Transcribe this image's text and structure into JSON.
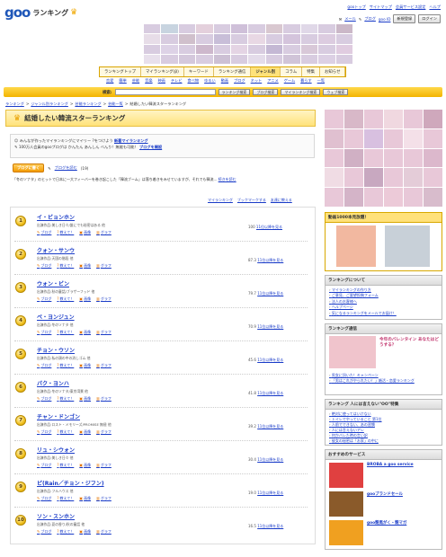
{
  "header": {
    "logo_text": "goo",
    "title": "ランキング",
    "top_links": [
      "gooトップ",
      "サイトマップ",
      "会員サービス設定",
      "ヘルプ"
    ],
    "user_links": [
      "メール",
      "ブログ",
      "goo ID"
    ],
    "register_button": "新規登録",
    "login_button": "ログイン"
  },
  "nav": {
    "tabs": [
      "ランキングトップ",
      "マイランキング(β)",
      "キーワード",
      "ランキング通信",
      "ジャンル別",
      "コラム",
      "特集",
      "お知らせ"
    ],
    "active_tab": "ジャンル別",
    "genres": [
      "恋愛",
      "簡単",
      "芸能",
      "音楽",
      "映画",
      "テレビ",
      "食べ物",
      "ゆるい",
      "動画",
      "ブログ",
      "ネット",
      "アニメ",
      "ゲーム",
      "暮らす",
      "一覧"
    ]
  },
  "search": {
    "label": "検索:",
    "placeholder": "",
    "buttons": [
      "ランキング検索",
      "ブログ検索",
      "マイランキング検索",
      "ウェブ検索"
    ]
  },
  "breadcrumb": [
    "ランキング",
    "ジャンル別ランキング",
    "芸能ランキング",
    "芸能一覧",
    "結婚したい韓流スターランキング"
  ],
  "page_title": "結婚したい韓流スターランキング",
  "info": {
    "line1_prefix": "みんなが作ったマイランキングにマイリー ?をつけよう",
    "line1_link": "新着マイランキング",
    "line2_prefix": "100万人会員のgooブログは かんたん あんしん べんり！無能も可能！",
    "line2_link": "ブログを開設"
  },
  "actions": {
    "blog_write": "ブログに書く",
    "blog_read": "ブログを読む",
    "blog_count": "(19)"
  },
  "description": "「冬のソナタ」のヒットで日本に一大フィーバーを巻き起こした「韓流ブーム」は落ち着きをみせていますが、それでも韓流...",
  "description_link": "続きを読む",
  "tools": [
    "マイランキング",
    "ブックマークする",
    "友達に教える"
  ],
  "rank_actions": [
    "ブログ",
    "教えて！",
    "画像",
    "グラフ"
  ],
  "ranking": [
    {
      "rank": "1",
      "name": "イ・ビョンホン",
      "sub": "出演作品:美しき日々/誰にでも秘密はある 他",
      "score": "100",
      "link": "11位以降を見る"
    },
    {
      "rank": "2",
      "name": "クォン・サンウ",
      "sub": "出演作品:天国の階段 他",
      "score": "87.3",
      "link": "11位以降を見る"
    },
    {
      "rank": "3",
      "name": "ウォン・ビン",
      "sub": "出演作品:秋の童話/ブラザーフッド 他",
      "score": "79.7",
      "link": "11位以降を見る"
    },
    {
      "rank": "4",
      "name": "ペ・ヨンジュン",
      "sub": "出演作品:冬のソナタ 他",
      "score": "70.9",
      "link": "11位以降を見る"
    },
    {
      "rank": "5",
      "name": "チョン・ウソン",
      "sub": "出演作品:私の頭の中の消しゴム 他",
      "score": "45.6",
      "link": "11位以降を見る"
    },
    {
      "rank": "6",
      "name": "パク・ヨンハ",
      "sub": "出演作品:冬のソナタ/東京湾景 他",
      "score": "41.8",
      "link": "11位以降を見る"
    },
    {
      "rank": "7",
      "name": "チャン・ドンゴン",
      "sub": "出演作品:ロスト・メモリーズ/PROMISE 無極 他",
      "score": "39.2",
      "link": "11位以降を見る"
    },
    {
      "rank": "8",
      "name": "リュ・シウォン",
      "sub": "出演作品:美しき日々 他",
      "score": "30.4",
      "link": "11位以降を見る"
    },
    {
      "rank": "9",
      "name": "ピ(Rain／チョン・ジフン)",
      "sub": "出演作品:フルハウス 他",
      "score": "19.0",
      "link": "11位以降を見る"
    },
    {
      "rank": "10",
      "name": "ソン・スンホン",
      "sub": "出演作品:夏の香り/秋の童話 他",
      "score": "16.5",
      "link": "11位以降を見る"
    }
  ],
  "sidebar": {
    "video_title": "動画1000本見放題！",
    "about": {
      "title": "ランキングについて",
      "items": [
        "マイランキングの作り方",
        "ご意見、ご要望投稿フォーム",
        "法人のお客様へ",
        "ヘルプページ",
        "気になるランキングをメールでお届け！"
      ]
    },
    "tsushin": {
      "title": "ランキング通信",
      "headline": "今年のバレンタイン あなたはどうする？",
      "items": [
        "男女に訊いた！キャンペーン",
        "「男はこれがやられたい！」婚活・恋愛ランキング"
      ]
    },
    "special": {
      "title": "ランキング 人には言えない\"OO\"特集",
      "items": [
        "絶対に使ってはいけない",
        "トイレでやっていること 第1位",
        "人前でできない、あの習慣",
        "人には言えないアレ",
        "何かバレた時の言い訳",
        "彼女の秘密は「お家」の中に"
      ]
    },
    "services": {
      "title": "おすすめのサービス",
      "items": [
        "BROBA a goo service",
        "gooブランドセール",
        "goo競馬がく・競マガ"
      ]
    }
  }
}
